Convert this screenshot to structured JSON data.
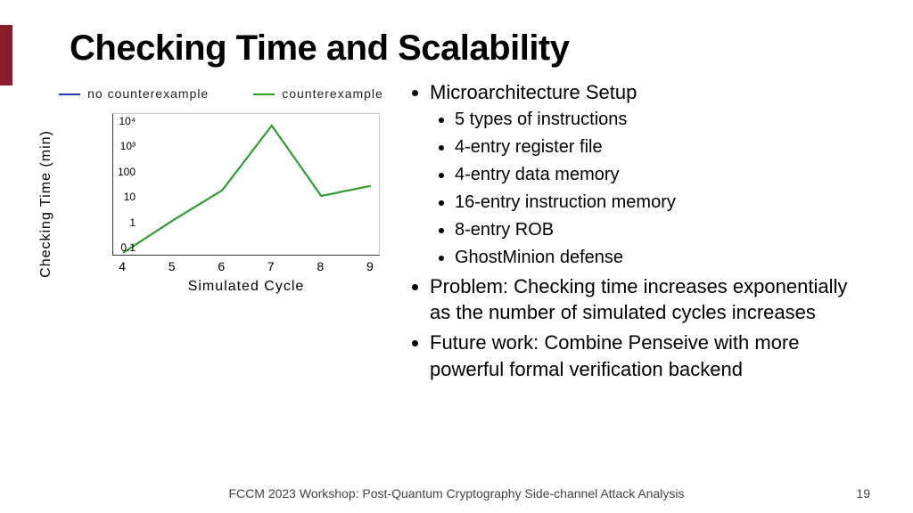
{
  "title": "Checking Time and Scalability",
  "legend": {
    "no_counter": "no counterexample",
    "counter": "counterexample"
  },
  "bullets": {
    "setup_head": "Microarchitecture Setup",
    "setup": [
      "5 types of instructions",
      "4-entry register file",
      "4-entry data memory",
      "16-entry instruction memory",
      "8-entry ROB",
      "GhostMinion defense"
    ],
    "problem": "Problem: Checking time increases exponentially as the number of simulated cycles increases",
    "future": "Future work: Combine Penseive with more powerful formal verification backend"
  },
  "footer": "FCCM 2023 Workshop: Post-Quantum Cryptography Side-channel Attack Analysis",
  "page": "19",
  "chart_data": {
    "type": "line",
    "title": "",
    "xlabel": "Simulated Cycle",
    "ylabel": "Checking Time (min)",
    "yscale": "log",
    "ylim": [
      0.05,
      20000
    ],
    "xlim": [
      3.8,
      9.2
    ],
    "x": [
      4,
      5,
      6,
      7,
      8,
      9
    ],
    "yticks": [
      0.1,
      1,
      10,
      100,
      1000,
      10000
    ],
    "ytick_labels": [
      "0.1",
      "1",
      "10",
      "100",
      "10³",
      "10⁴"
    ],
    "series": [
      {
        "name": "counterexample",
        "color": "#2e9e2e",
        "values": [
          0.07,
          1.3,
          20,
          7000,
          12,
          30
        ]
      }
    ],
    "legend_entries": [
      "no counterexample",
      "counterexample"
    ]
  }
}
